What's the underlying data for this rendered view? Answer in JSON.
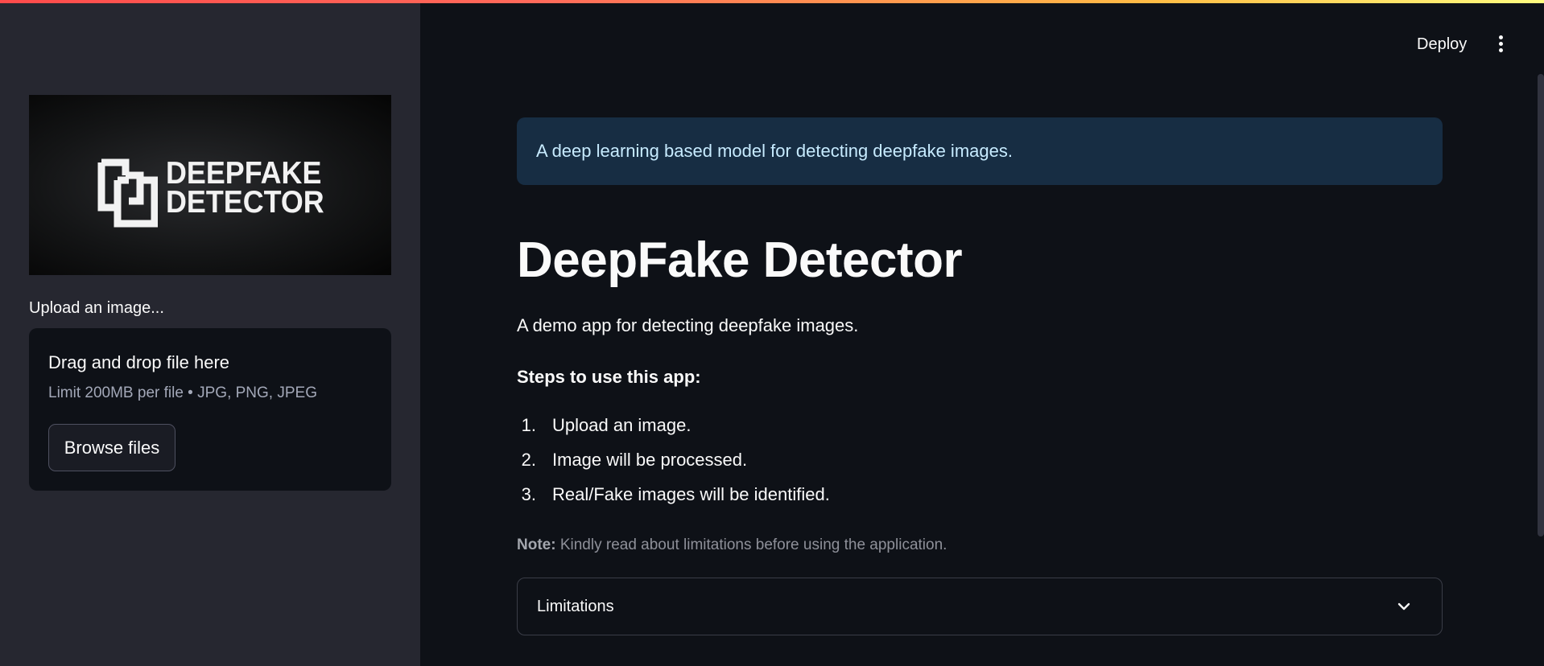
{
  "sidebar": {
    "logo": {
      "line1": "DEEPFAKE",
      "line2": "DETECTOR"
    },
    "upload_label": "Upload an image...",
    "dropzone": {
      "title": "Drag and drop file here",
      "subtitle": "Limit 200MB per file • JPG, PNG, JPEG",
      "browse_label": "Browse files"
    }
  },
  "header": {
    "deploy_label": "Deploy",
    "menu_icon": "kebab-menu-icon"
  },
  "main": {
    "info_text": "A deep learning based model for detecting deepfake images.",
    "title": "DeepFake Detector",
    "subtitle": "A demo app for detecting deepfake images.",
    "steps_title": "Steps to use this app:",
    "steps": [
      {
        "num": "1.",
        "text": "Upload an image."
      },
      {
        "num": "2.",
        "text": "Image will be processed."
      },
      {
        "num": "3.",
        "text": "Real/Fake images will be identified."
      }
    ],
    "note_label": "Note:",
    "note_text": " Kindly read about limitations before using the application.",
    "expander_label": "Limitations",
    "expander_icon": "chevron-down-icon"
  },
  "colors": {
    "background": "#0e1117",
    "sidebar": "#262730",
    "info_box": "#172d43",
    "info_text": "#c7ebff",
    "accent_gradient_start": "#ff4b4b",
    "accent_gradient_end": "#fffd80"
  }
}
